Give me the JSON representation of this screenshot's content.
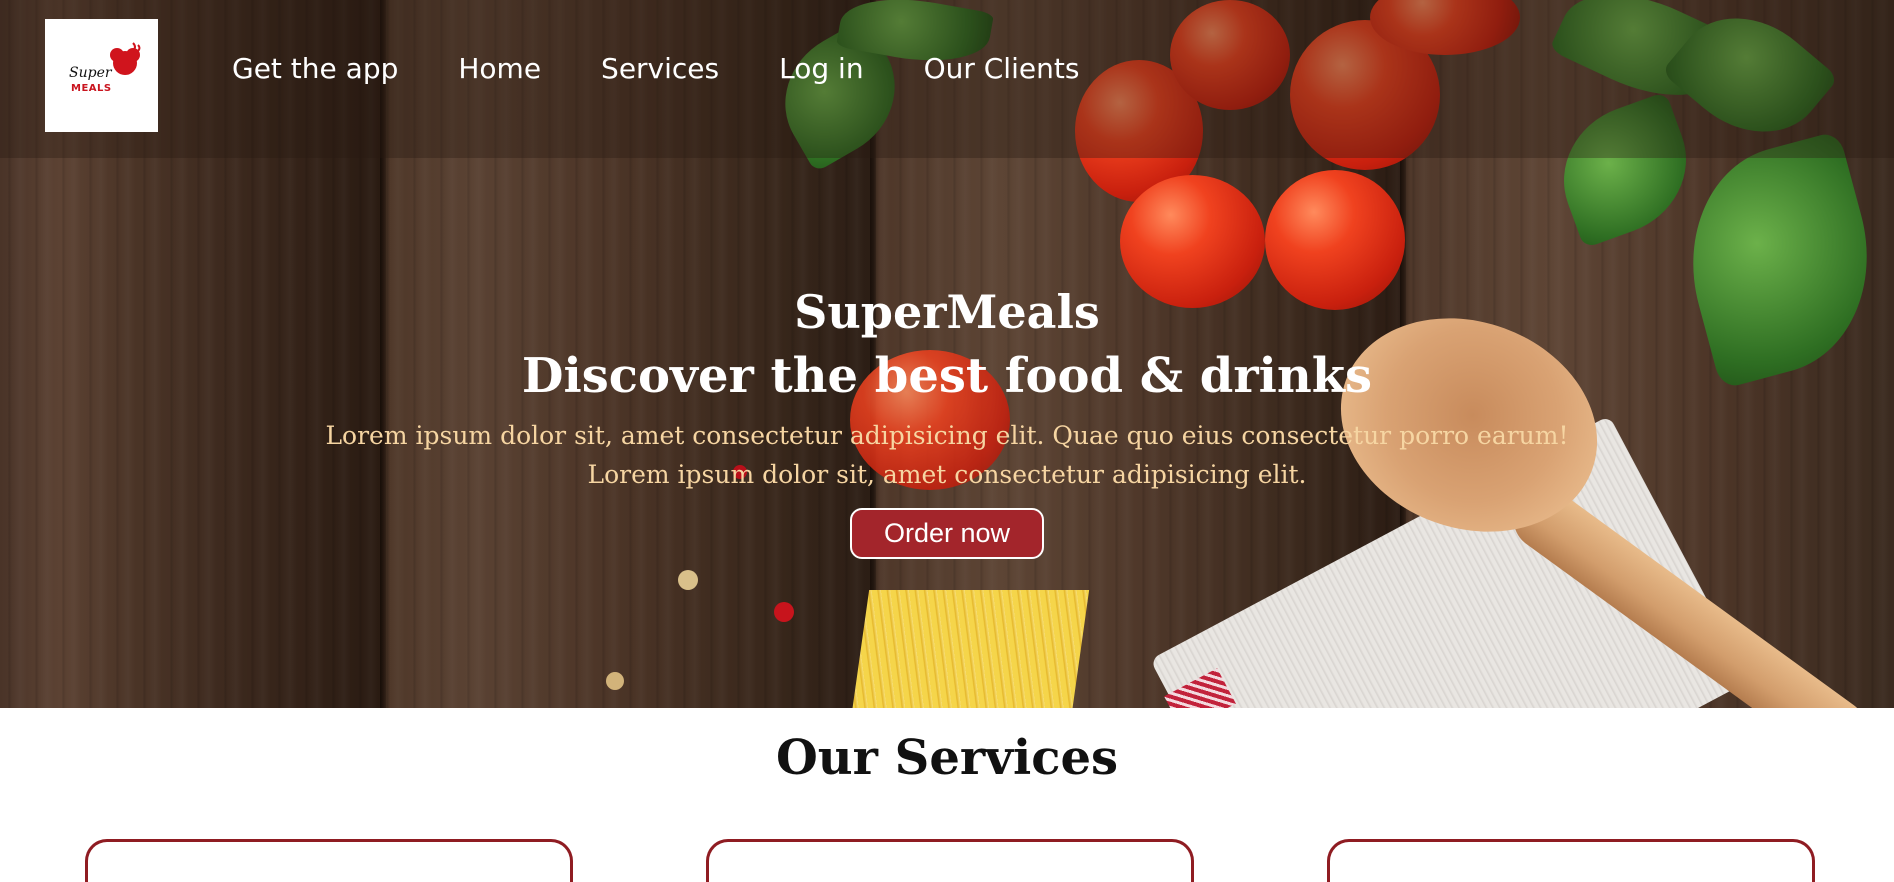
{
  "header": {
    "logo": {
      "text_top": "Super",
      "text_bottom": "MEALS"
    },
    "nav": [
      {
        "label": "Get the app"
      },
      {
        "label": "Home"
      },
      {
        "label": "Services"
      },
      {
        "label": "Log in"
      },
      {
        "label": "Our Clients"
      }
    ]
  },
  "hero": {
    "brand": "SuperMeals",
    "tagline": "Discover the best food & drinks",
    "description_line1": "Lorem ipsum dolor sit, amet consectetur adipisicing elit. Quae quo eius consectetur porro earum!",
    "description_line2": "Lorem ipsum dolor sit, amet consectetur adipisicing elit.",
    "cta_label": "Order now"
  },
  "services": {
    "title": "Our Services"
  },
  "colors": {
    "accent": "#a3252b",
    "description_text": "#f6d5a2"
  }
}
